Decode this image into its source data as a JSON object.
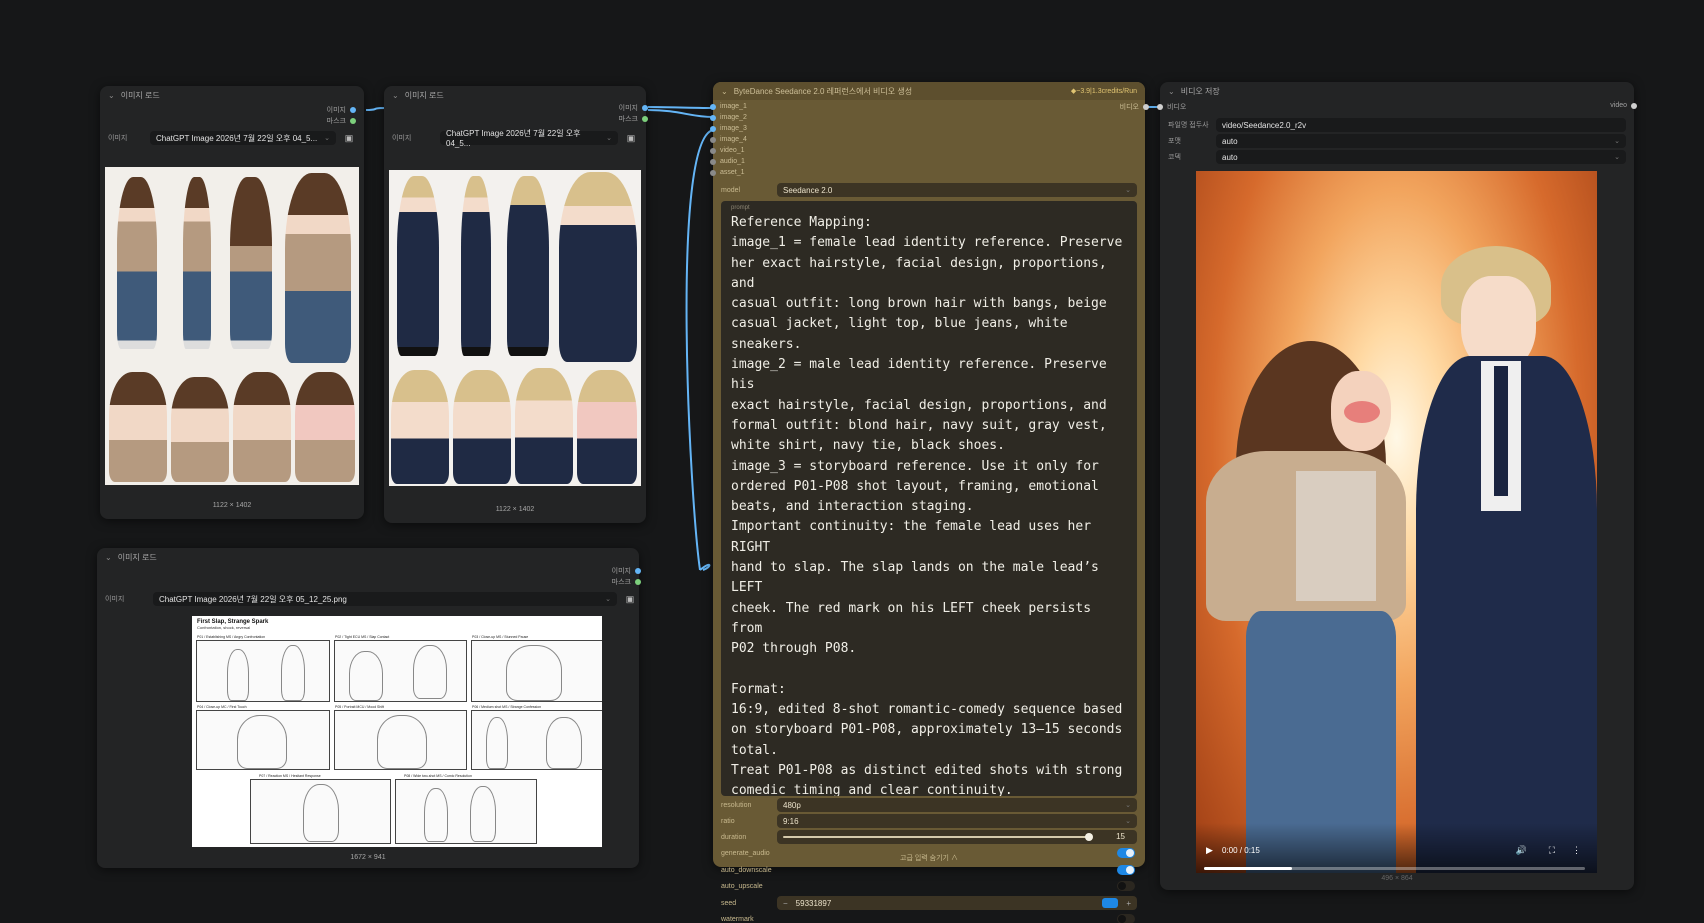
{
  "load_image_nodes": [
    {
      "title": "이미지 로드",
      "out_image": "이미지",
      "out_mask": "마스크",
      "widget_label": "이미지",
      "filename": "ChatGPT Image 2026년 7월 22일 오후 04_5...",
      "dims": "1122 × 1402"
    },
    {
      "title": "이미지 로드",
      "out_image": "이미지",
      "out_mask": "마스크",
      "widget_label": "이미지",
      "filename": "ChatGPT Image 2026년 7월 22일 오후 04_5...",
      "dims": "1122 × 1402"
    },
    {
      "title": "이미지 로드",
      "out_image": "이미지",
      "out_mask": "마스크",
      "widget_label": "이미지",
      "filename": "ChatGPT Image 2026년 7월 22일 오후 05_12_25.png",
      "dims": "1672 × 941"
    }
  ],
  "storyboard": {
    "title": "First Slap, Strange Spark",
    "subtitle": "Confrontation, shock, reversal",
    "panels": [
      "P01 / Establishing MS / Angry Confrontation",
      "P02 / Tight ECU MS / Slap Contact",
      "P03 / Close-up MS / Stunned Pause",
      "P04 / Close-up MC / First Touch",
      "P05 / Portrait MCU / Mood Shift",
      "P06 / Medium shot MS / Strange Confession",
      "P07 / Reaction MS / Hesitant Response",
      "P08 / Wide two-shot MS / Comic Resolution"
    ]
  },
  "seedance": {
    "title": "ByteDance Seedance 2.0 레퍼런스에서 비디오 생성",
    "badge": "◆~3.9|1.3credits/Run",
    "out_video": "비디오",
    "inputs": [
      "image_1",
      "image_2",
      "image_3",
      "image_4",
      "video_1",
      "audio_1",
      "asset_1"
    ],
    "model_label": "model",
    "model_value": "Seedance 2.0",
    "prompt_tag": "prompt",
    "prompt": "Reference Mapping:\nimage_1 = female lead identity reference. Preserve\nher exact hairstyle, facial design, proportions, and\ncasual outfit: long brown hair with bangs, beige\ncasual jacket, light top, blue jeans, white\nsneakers.\nimage_2 = male lead identity reference. Preserve his\nexact hairstyle, facial design, proportions, and\nformal outfit: blond hair, navy suit, gray vest,\nwhite shirt, navy tie, black shoes.\nimage_3 = storyboard reference. Use it only for\nordered P01-P08 shot layout, framing, emotional\nbeats, and interaction staging.\nImportant continuity: the female lead uses her RIGHT\nhand to slap. The slap lands on the male lead’s LEFT\ncheek. The red mark on his LEFT cheek persists from\nP02 through P08.\n\nFormat:\n16:9, edited 8-shot romantic-comedy sequence based\non storyboard P01-P08, approximately 13–15 seconds\ntotal.\nTreat P01-P08 as distinct edited shots with strong\ncomedic timing and clear continuity.",
    "resolution_label": "resolution",
    "resolution_value": "480p",
    "ratio_label": "ratio",
    "ratio_value": "9:16",
    "duration_label": "duration",
    "duration_value": "15",
    "duration_fraction": 1.0,
    "generate_audio_label": "generate_audio",
    "auto_downscale_label": "auto_downscale",
    "auto_upscale_label": "auto_upscale",
    "seed_label": "seed",
    "seed_value": "59331897",
    "seed_dec": "−",
    "seed_inc": "+",
    "watermark_label": "watermark",
    "advanced_toggle": "고급 입력 숨기기 ∧",
    "toggles": {
      "generate_audio": true,
      "auto_downscale": true,
      "auto_upscale": false,
      "watermark": false
    }
  },
  "save_video": {
    "title": "비디오 저장",
    "in_video": "비디오",
    "out_video": "video",
    "filename_prefix_label": "파일명 접두사",
    "filename_prefix_value": "video/Seedance2.0_r2v",
    "format_label": "포맷",
    "format_value": "auto",
    "codec_label": "코덱",
    "codec_value": "auto",
    "time": "0:00 / 0:15",
    "progress_fraction": 0.23,
    "dims": "496 × 864"
  },
  "colors": {
    "canvas": "#161718",
    "node": "#232425",
    "seedance_node": "#695a35",
    "wire": "#64b5f6",
    "toggle_on": "#1e88e5"
  }
}
